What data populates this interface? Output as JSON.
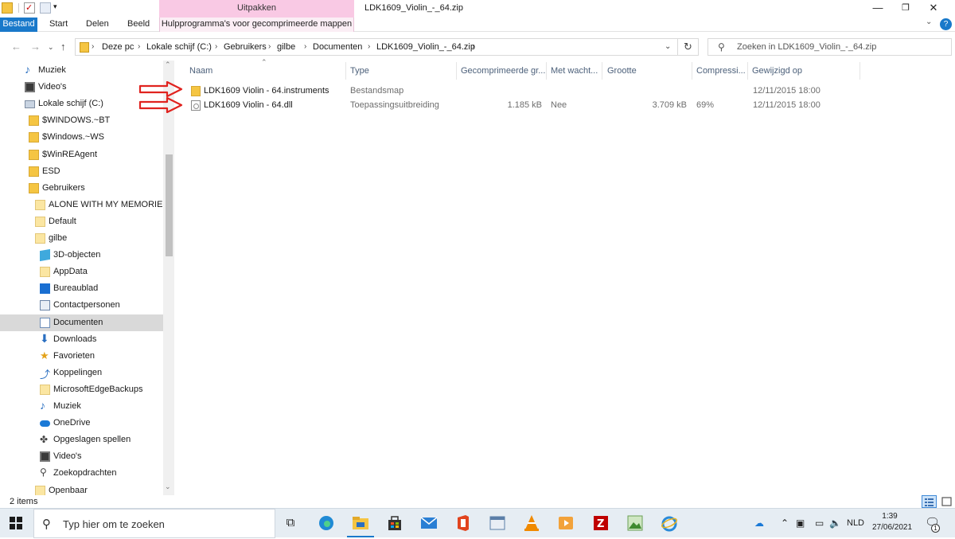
{
  "window": {
    "title": "LDK1609_Violin_-_64.zip",
    "context_tab_group": "Uitpakken",
    "min_glyph": "—",
    "max_glyph": "❐",
    "close_glyph": "✕"
  },
  "ribbon": {
    "tabs": [
      "Bestand",
      "Start",
      "Delen",
      "Beeld",
      "Hulpprogramma's voor gecomprimeerde mappen"
    ],
    "accent": "#1979ca",
    "context_color": "#f9c9e4",
    "help": "?"
  },
  "address": {
    "crumbs": [
      "Deze pc",
      "Lokale schijf (C:)",
      "Gebruikers",
      "gilbe",
      "Documenten",
      "LDK1609_Violin_-_64.zip"
    ],
    "chevron": "›",
    "dropdown": "⌄",
    "refresh": "↻"
  },
  "search": {
    "placeholder": "Zoeken in LDK1609_Violin_-_64.zip",
    "icon": "search-icon"
  },
  "nav": {
    "items": [
      {
        "label": "Muziek",
        "icon": "music-icon"
      },
      {
        "label": "Video's",
        "icon": "video-icon"
      },
      {
        "label": "Lokale schijf (C:)",
        "icon": "drive-icon"
      },
      {
        "label": "$WINDOWS.~BT",
        "icon": "folder-icon"
      },
      {
        "label": "$Windows.~WS",
        "icon": "folder-icon"
      },
      {
        "label": "$WinREAgent",
        "icon": "folder-icon"
      },
      {
        "label": "ESD",
        "icon": "folder-icon"
      },
      {
        "label": "Gebruikers",
        "icon": "folder-icon"
      },
      {
        "label": "ALONE WITH MY MEMORIES",
        "icon": "folder-icon"
      },
      {
        "label": "Default",
        "icon": "folder-icon"
      },
      {
        "label": "gilbe",
        "icon": "folder-icon"
      },
      {
        "label": "3D-objecten",
        "icon": "3d-objects-icon"
      },
      {
        "label": "AppData",
        "icon": "folder-icon"
      },
      {
        "label": "Bureaublad",
        "icon": "desktop-icon"
      },
      {
        "label": "Contactpersonen",
        "icon": "contacts-icon"
      },
      {
        "label": "Documenten",
        "icon": "documents-icon"
      },
      {
        "label": "Downloads",
        "icon": "download-icon"
      },
      {
        "label": "Favorieten",
        "icon": "star-icon"
      },
      {
        "label": "Koppelingen",
        "icon": "link-icon"
      },
      {
        "label": "MicrosoftEdgeBackups",
        "icon": "folder-icon"
      },
      {
        "label": "Muziek",
        "icon": "music-icon"
      },
      {
        "label": "OneDrive",
        "icon": "onedrive-icon"
      },
      {
        "label": "Opgeslagen spellen",
        "icon": "games-icon"
      },
      {
        "label": "Video's",
        "icon": "video-icon"
      },
      {
        "label": "Zoekopdrachten",
        "icon": "search-icon"
      },
      {
        "label": "Openbaar",
        "icon": "folder-icon"
      }
    ],
    "selected": "Documenten"
  },
  "columns": [
    "Naam",
    "Type",
    "Gecomprimeerde gr...",
    "Met wacht...",
    "Grootte",
    "Compressi...",
    "Gewijzigd op"
  ],
  "files": [
    {
      "name": "LDK1609 Violin - 64.instruments",
      "type": "Bestandsmap",
      "compressed": "",
      "password": "",
      "size": "",
      "ratio": "",
      "modified": "12/11/2015 18:00",
      "icon": "folder-icon"
    },
    {
      "name": "LDK1609 Violin - 64.dll",
      "type": "Toepassingsuitbreiding",
      "compressed": "1.185 kB",
      "password": "Nee",
      "size": "3.709 kB",
      "ratio": "69%",
      "modified": "12/11/2015 18:00",
      "icon": "dll-file-icon"
    }
  ],
  "status": {
    "count": "2 items"
  },
  "taskbar": {
    "search_placeholder": "Typ hier om te zoeken",
    "language": "NLD",
    "time": "1:39",
    "date": "27/06/2021",
    "notifications": "1"
  }
}
